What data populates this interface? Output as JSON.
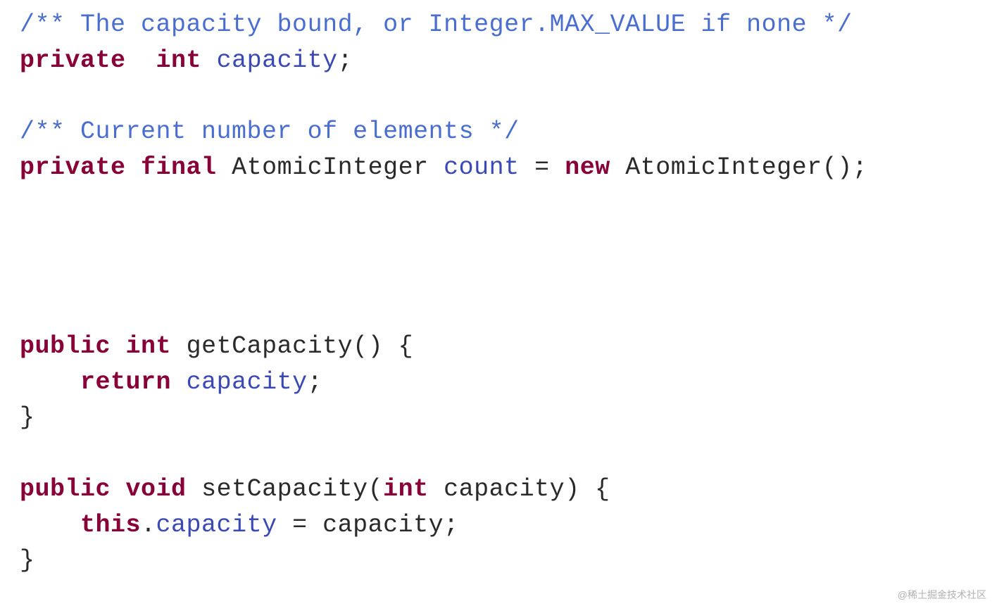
{
  "code": {
    "lines": [
      {
        "tokens": [
          {
            "cls": "comment",
            "t": "/** The capacity bound, or Integer.MAX_VALUE if none */"
          }
        ]
      },
      {
        "tokens": [
          {
            "cls": "keyword",
            "t": "private"
          },
          {
            "cls": "ident",
            "t": "  "
          },
          {
            "cls": "keyword",
            "t": "int"
          },
          {
            "cls": "ident",
            "t": " "
          },
          {
            "cls": "name",
            "t": "capacity"
          },
          {
            "cls": "punct",
            "t": ";"
          }
        ]
      },
      {
        "tokens": [
          {
            "cls": "ident",
            "t": ""
          }
        ]
      },
      {
        "tokens": [
          {
            "cls": "comment",
            "t": "/** Current number of elements */"
          }
        ]
      },
      {
        "tokens": [
          {
            "cls": "keyword",
            "t": "private"
          },
          {
            "cls": "ident",
            "t": " "
          },
          {
            "cls": "keyword",
            "t": "final"
          },
          {
            "cls": "ident",
            "t": " AtomicInteger "
          },
          {
            "cls": "name",
            "t": "count"
          },
          {
            "cls": "ident",
            "t": " = "
          },
          {
            "cls": "keyword",
            "t": "new"
          },
          {
            "cls": "ident",
            "t": " AtomicInteger();"
          }
        ]
      },
      {
        "tokens": [
          {
            "cls": "ident",
            "t": ""
          }
        ]
      },
      {
        "tokens": [
          {
            "cls": "ident",
            "t": ""
          }
        ]
      },
      {
        "tokens": [
          {
            "cls": "ident",
            "t": ""
          }
        ]
      },
      {
        "tokens": [
          {
            "cls": "ident",
            "t": ""
          }
        ]
      },
      {
        "tokens": [
          {
            "cls": "keyword",
            "t": "public"
          },
          {
            "cls": "ident",
            "t": " "
          },
          {
            "cls": "keyword",
            "t": "int"
          },
          {
            "cls": "ident",
            "t": " getCapacity() {"
          }
        ]
      },
      {
        "tokens": [
          {
            "cls": "ident",
            "t": "    "
          },
          {
            "cls": "keyword",
            "t": "return"
          },
          {
            "cls": "ident",
            "t": " "
          },
          {
            "cls": "name",
            "t": "capacity"
          },
          {
            "cls": "punct",
            "t": ";"
          }
        ]
      },
      {
        "tokens": [
          {
            "cls": "ident",
            "t": "}"
          }
        ]
      },
      {
        "tokens": [
          {
            "cls": "ident",
            "t": ""
          }
        ]
      },
      {
        "tokens": [
          {
            "cls": "keyword",
            "t": "public"
          },
          {
            "cls": "ident",
            "t": " "
          },
          {
            "cls": "keyword",
            "t": "void"
          },
          {
            "cls": "ident",
            "t": " setCapacity("
          },
          {
            "cls": "keyword",
            "t": "int"
          },
          {
            "cls": "ident",
            "t": " capacity) {"
          }
        ]
      },
      {
        "tokens": [
          {
            "cls": "ident",
            "t": "    "
          },
          {
            "cls": "keyword",
            "t": "this"
          },
          {
            "cls": "punct",
            "t": "."
          },
          {
            "cls": "name",
            "t": "capacity"
          },
          {
            "cls": "ident",
            "t": " = capacity;"
          }
        ]
      },
      {
        "tokens": [
          {
            "cls": "ident",
            "t": "}"
          }
        ]
      }
    ]
  },
  "watermark": "@稀土掘金技术社区"
}
